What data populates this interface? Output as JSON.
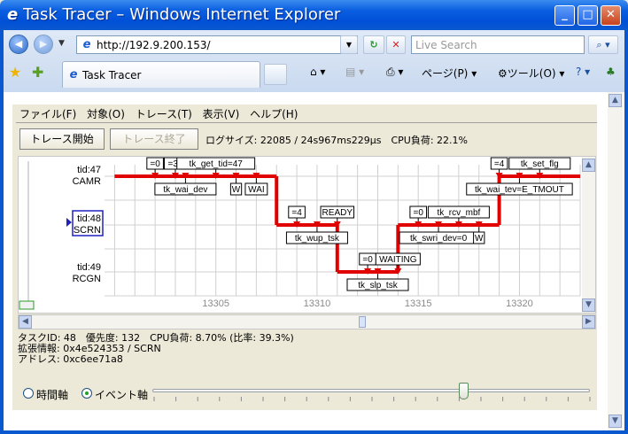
{
  "window": {
    "title": "Task Tracer – Windows Internet Explorer"
  },
  "browser": {
    "url": "http://192.9.200.153/",
    "search_placeholder": "Live Search",
    "tab_title": "Task Tracer",
    "cmd_page": "ページ(P)",
    "cmd_tools": "ツール(O)"
  },
  "app": {
    "menu": [
      "ファイル(F)",
      "対象(O)",
      "トレース(T)",
      "表示(V)",
      "ヘルプ(H)"
    ],
    "start_button": "トレース開始",
    "stop_button": "トレース終了",
    "stats": "ログサイズ: 22085 / 24s967ms229μs　CPU負荷: 22.1%",
    "info_line1": "タスクID: 48　優先度: 132　CPU負荷: 8.70% (比率: 39.3%)",
    "info_line2": "拡張情報: 0x4e524353 / SCRN",
    "info_line3": "アドレス: 0xc6ee71a8",
    "radio_time": "時間軸",
    "radio_event": "イベント軸",
    "axis_mode": "event",
    "slider_value_fraction": 0.71
  },
  "chart_data": {
    "type": "timeline",
    "tasks": [
      {
        "id_label": "tid:47",
        "name": "CAMR"
      },
      {
        "id_label": "tid:48",
        "name": "SCRN"
      },
      {
        "id_label": "tid:49",
        "name": "RCGN"
      }
    ],
    "x_ticks": [
      "13305",
      "13310",
      "13315",
      "13320"
    ],
    "above_labels": [
      {
        "text": "=0",
        "x": 13302.0,
        "task": 0
      },
      {
        "text": "=37",
        "x": 13303.0,
        "task": 0
      },
      {
        "text": "tk_get_tid=47",
        "x": 13305.0,
        "task": 0
      },
      {
        "text": "=4",
        "x": 13309.0,
        "task": 1
      },
      {
        "text": "READY",
        "x": 13311.0,
        "task": 1
      },
      {
        "text": "=0",
        "x": 13315.0,
        "task": 1
      },
      {
        "text": "tk_rcv_mbf",
        "x": 13317.0,
        "task": 1
      },
      {
        "text": "=0",
        "x": 13312.5,
        "task": 2
      },
      {
        "text": "WAITING",
        "x": 13314.0,
        "task": 2
      },
      {
        "text": "=4",
        "x": 13319.0,
        "task": 0
      },
      {
        "text": "tk_set_flg",
        "x": 13321.0,
        "task": 0
      }
    ],
    "below_labels": [
      {
        "text": "tk_wai_dev",
        "x": 13303.5,
        "task": 0
      },
      {
        "text": "W",
        "x": 13306.0,
        "task": 0
      },
      {
        "text": "WAI",
        "x": 13307.0,
        "task": 0
      },
      {
        "text": "tk_wup_tsk",
        "x": 13310.0,
        "task": 1
      },
      {
        "text": "tk_swri_dev=0",
        "x": 13316.0,
        "task": 1
      },
      {
        "text": "W",
        "x": 13318.0,
        "task": 1
      },
      {
        "text": "tk_slp_tsk",
        "x": 13313.0,
        "task": 2
      },
      {
        "text": "tk_wai_tev=E_TMOUT",
        "x": 13320.0,
        "task": 0
      }
    ],
    "running_segments": [
      {
        "task": 0,
        "x_start": 13300.0,
        "x_end": 13308.0
      },
      {
        "task": 1,
        "x_start": 13308.0,
        "x_end": 13311.0
      },
      {
        "task": 2,
        "x_start": 13311.0,
        "x_end": 13314.0
      },
      {
        "task": 1,
        "x_start": 13314.0,
        "x_end": 13319.0
      },
      {
        "task": 0,
        "x_start": 13319.0,
        "x_end": 13323.0
      }
    ],
    "xlim": [
      13299.5,
      13323.0
    ],
    "selected_task": 1,
    "line_color": "#e00000"
  }
}
